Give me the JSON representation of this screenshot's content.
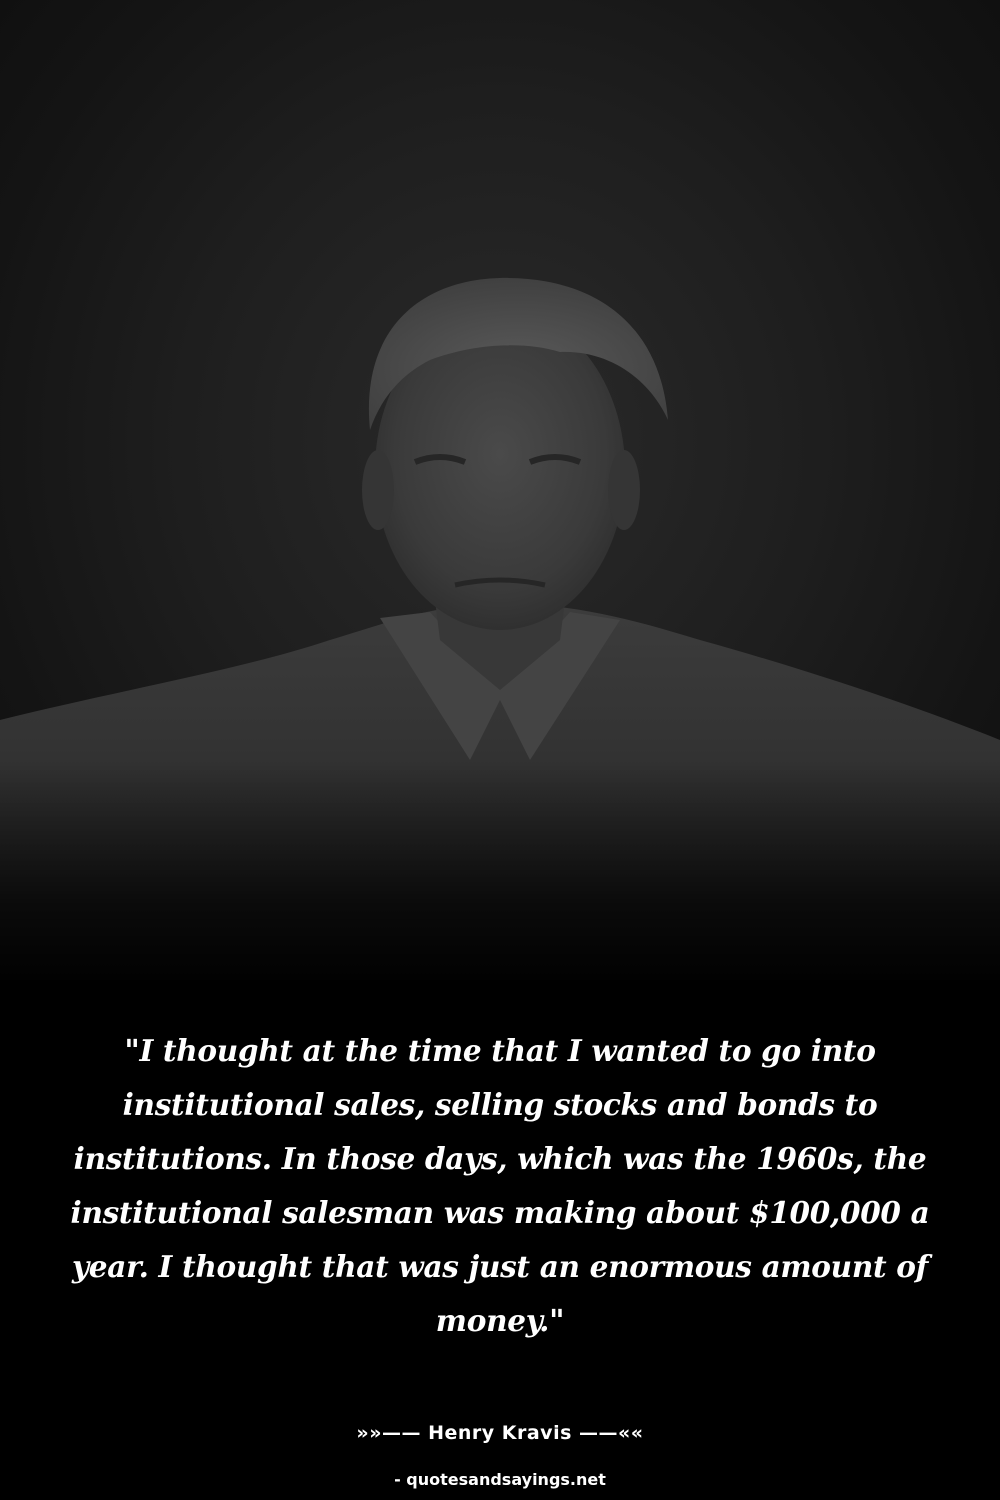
{
  "quote": {
    "text": "\"I thought at the time that I wanted to go into institutional sales, selling stocks and bonds to institutions. In those days, which was the 1960s, the institutional salesman was making about $100,000 a year. I thought that was just an enormous amount of money.\"",
    "author": "»»—— Henry Kravis ——««"
  },
  "footer": {
    "source": "- quotesandsayings.net"
  },
  "colors": {
    "background": "#000000",
    "text": "#ffffff"
  }
}
